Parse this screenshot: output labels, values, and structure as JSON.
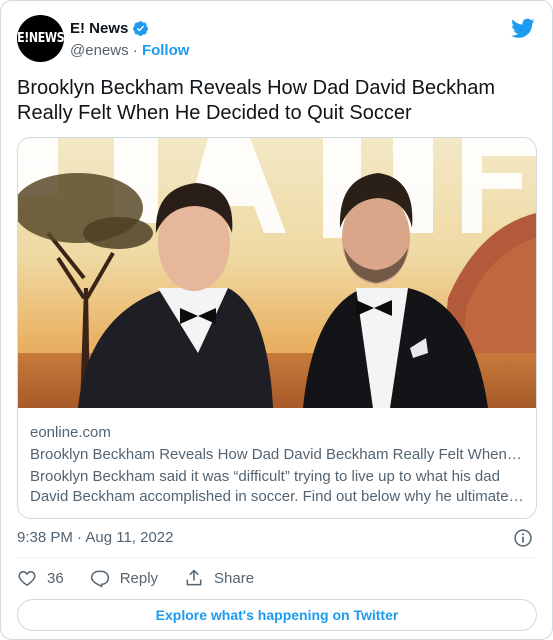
{
  "author": {
    "avatar_text": "E!NEWS",
    "display_name": "E! News",
    "handle": "@enews",
    "separator": "·",
    "follow_label": "Follow"
  },
  "tweet": {
    "text": "Brooklyn Beckham Reveals How Dad David Beckham Really Felt When He Decided to Quit Soccer"
  },
  "link_card": {
    "domain": "eonline.com",
    "title": "Brooklyn Beckham Reveals How Dad David Beckham Really Felt When H...",
    "description_line1": "Brooklyn Beckham said it was “difficult” trying to live up to what his dad",
    "description_line2": "David Beckham accomplished in soccer. Find out below why he ultimatel...",
    "image_subject": "photo-brooklyn-and-david-beckham"
  },
  "meta": {
    "timestamp": "9:38 PM · Aug 11, 2022"
  },
  "actions": {
    "like_count": "36",
    "reply_label": "Reply",
    "share_label": "Share"
  },
  "footer": {
    "explore_label": "Explore what's happening on Twitter"
  },
  "colors": {
    "accent": "#1d9bf0",
    "secondary_text": "#536471",
    "border": "#cfd9de"
  }
}
